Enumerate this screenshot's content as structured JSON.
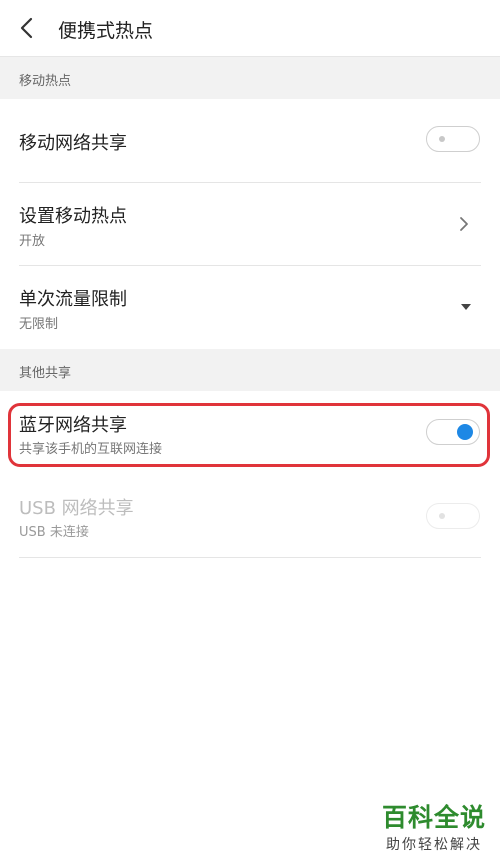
{
  "header": {
    "title": "便携式热点"
  },
  "sections": {
    "mobile_hotspot": "移动热点",
    "other_sharing": "其他共享"
  },
  "rows": {
    "mobile_network_share": {
      "label": "移动网络共享",
      "state": "off"
    },
    "setup_hotspot": {
      "label": "设置移动热点",
      "sub": "开放"
    },
    "traffic_limit": {
      "label": "单次流量限制",
      "sub": "无限制"
    },
    "bluetooth_share": {
      "label": "蓝牙网络共享",
      "sub": "共享该手机的互联网连接",
      "state": "on"
    },
    "usb_share": {
      "label": "USB 网络共享",
      "sub": "USB 未连接",
      "state": "disabled"
    }
  },
  "colors": {
    "accent": "#1e88e5",
    "highlight_border": "#e0343a",
    "watermark_green": "#2e8b2e"
  },
  "watermark": {
    "main": "百科全说",
    "sub": "助你轻松解决"
  },
  "icons": {
    "back": "back-arrow-icon",
    "chevron": "chevron-right-icon",
    "dropdown": "dropdown-arrow-icon"
  }
}
